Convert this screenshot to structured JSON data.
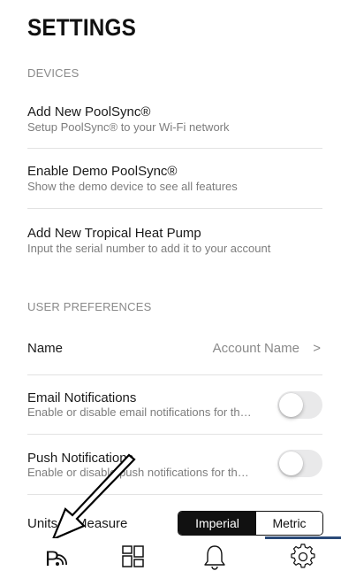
{
  "page": {
    "title": "SETTINGS"
  },
  "devices": {
    "header": "DEVICES",
    "items": [
      {
        "title": "Add New PoolSync®",
        "subtitle": "Setup PoolSync® to your Wi-Fi network"
      },
      {
        "title": "Enable Demo PoolSync®",
        "subtitle": "Show the demo device to see all features"
      },
      {
        "title": "Add New Tropical Heat Pump",
        "subtitle": "Input the serial number to add it to your account"
      }
    ]
  },
  "user_preferences": {
    "header": "USER PREFERENCES",
    "name": {
      "label": "Name",
      "value": "Account Name",
      "chevron": ">"
    },
    "email": {
      "label": "Email Notifications",
      "subtitle": "Enable or disable email notifications for th…",
      "enabled": false
    },
    "push": {
      "label": "Push Notifications",
      "subtitle": "Enable or disable push notifications for th…",
      "enabled": false
    },
    "units": {
      "label": "Units of Measure",
      "options": [
        "Imperial",
        "Metric"
      ],
      "selected": "Imperial"
    }
  },
  "tabbar": {
    "tabs": [
      {
        "icon": "poolsync-icon"
      },
      {
        "icon": "dashboard-icon"
      },
      {
        "icon": "bell-icon"
      },
      {
        "icon": "gear-icon"
      }
    ],
    "active_index": 3
  },
  "colors": {
    "accent": "#2a4a78",
    "toggle_off": "#e9e9ea",
    "segment_active": "#111111"
  }
}
